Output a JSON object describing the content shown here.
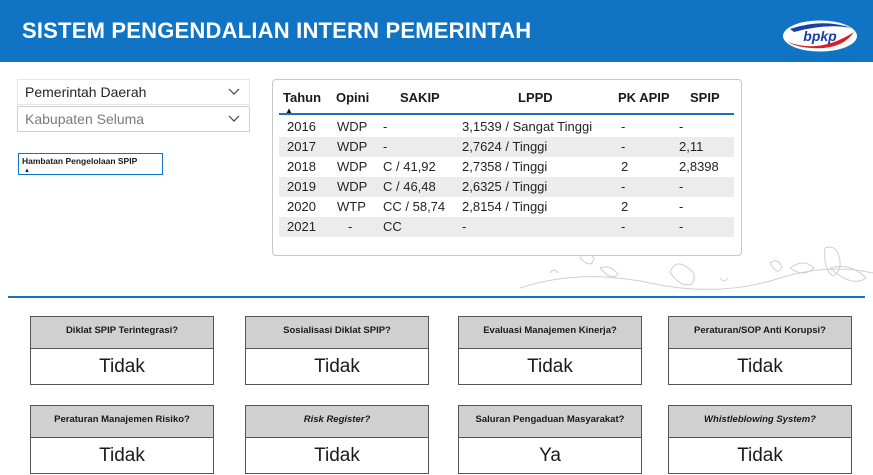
{
  "header": {
    "title": "SISTEM PENGENDALIAN INTERN PEMERINTAH",
    "logo_text": "bpkp"
  },
  "slicers": {
    "level": "Pemerintah Daerah",
    "region": "Kabupaten Seluma"
  },
  "hambatan_button": {
    "label": "Hambatan Pengelolaan SPIP",
    "icon": "sort-up-icon"
  },
  "table": {
    "columns": [
      "Tahun",
      "Opini",
      "SAKIP",
      "LPPD",
      "PK APIP",
      "SPIP"
    ],
    "rows": [
      [
        "2016",
        "WDP",
        "-",
        "3,1539 / Sangat Tinggi",
        "-",
        "-"
      ],
      [
        "2017",
        "WDP",
        "-",
        "2,7624 / Tinggi",
        "-",
        "2,11"
      ],
      [
        "2018",
        "WDP",
        "C / 41,92",
        "2,7358 / Tinggi",
        "2",
        "2,8398"
      ],
      [
        "2019",
        "WDP",
        "C / 46,48",
        "2,6325 / Tinggi",
        "-",
        "-"
      ],
      [
        "2020",
        "WTP",
        "CC / 58,74",
        "2,8154 / Tinggi",
        "2",
        "-"
      ],
      [
        "2021",
        "-",
        "CC",
        "-",
        "-",
        "-"
      ]
    ]
  },
  "cards": [
    {
      "title": "Diklat SPIP Terintegrasi?",
      "value": "Tidak"
    },
    {
      "title": "Sosialisasi Diklat SPIP?",
      "value": "Tidak"
    },
    {
      "title": "Evaluasi Manajemen Kinerja?",
      "value": "Tidak"
    },
    {
      "title": "Peraturan/SOP Anti Korupsi?",
      "value": "Tidak"
    },
    {
      "title": "Peraturan Manajemen Risiko?",
      "value": "Tidak"
    },
    {
      "title": "Risk Register?",
      "value": "Tidak"
    },
    {
      "title": "Saluran Pengaduan Masyarakat?",
      "value": "Ya"
    },
    {
      "title": "Whistleblowing System?",
      "value": "Tidak"
    }
  ],
  "colors": {
    "header": "#1173c3",
    "accent_line": "#1f6fbf",
    "card_header": "#d0d0d0",
    "logo_blue": "#1a3fa8",
    "logo_red": "#d71f26"
  }
}
